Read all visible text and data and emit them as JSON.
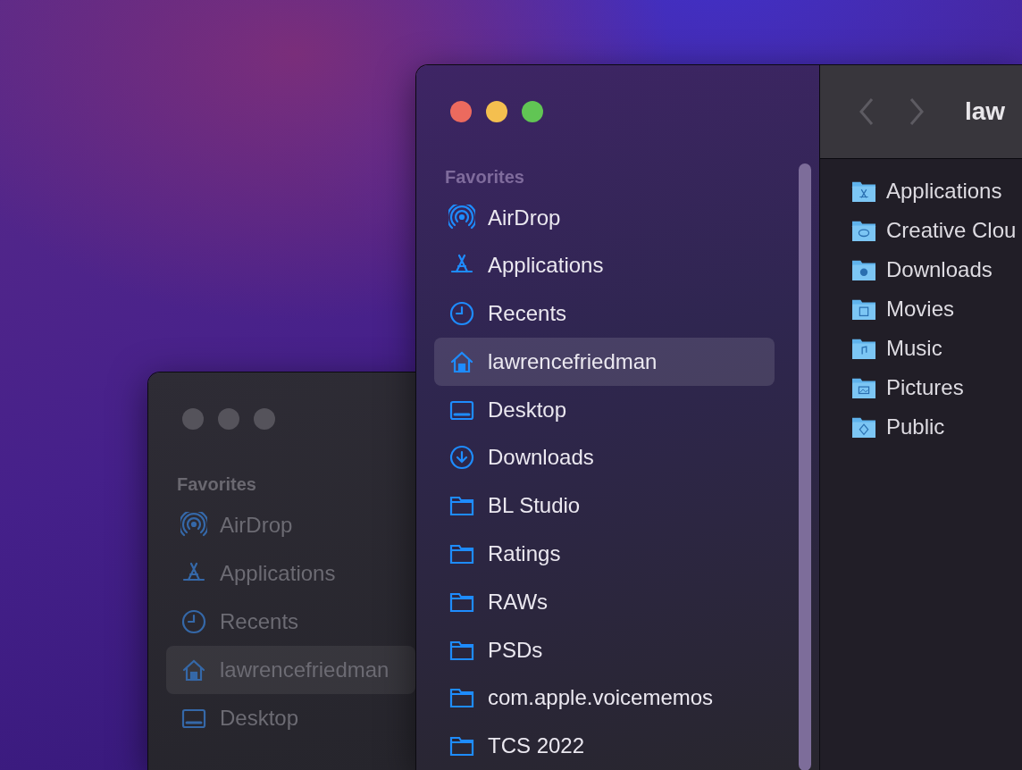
{
  "front_window": {
    "active": true,
    "title": "law",
    "sidebar": {
      "section": "Favorites",
      "items": [
        {
          "label": "AirDrop",
          "kind": "airdrop",
          "selected": false
        },
        {
          "label": "Applications",
          "kind": "apps",
          "selected": false
        },
        {
          "label": "Recents",
          "kind": "clock",
          "selected": false
        },
        {
          "label": "lawrencefriedman",
          "kind": "home",
          "selected": true
        },
        {
          "label": "Desktop",
          "kind": "desktop",
          "selected": false
        },
        {
          "label": "Downloads",
          "kind": "download",
          "selected": false
        },
        {
          "label": "BL Studio",
          "kind": "folder",
          "selected": false
        },
        {
          "label": "Ratings",
          "kind": "folder",
          "selected": false
        },
        {
          "label": "RAWs",
          "kind": "folder",
          "selected": false
        },
        {
          "label": "PSDs",
          "kind": "folder",
          "selected": false
        },
        {
          "label": "com.apple.voicememos",
          "kind": "folder",
          "selected": false
        },
        {
          "label": "TCS 2022",
          "kind": "folder",
          "selected": false
        }
      ]
    },
    "files": [
      {
        "name": "Applications",
        "kind": "apps"
      },
      {
        "name": "Creative Clou",
        "kind": "cloud"
      },
      {
        "name": "Downloads",
        "kind": "download"
      },
      {
        "name": "Movies",
        "kind": "film"
      },
      {
        "name": "Music",
        "kind": "music"
      },
      {
        "name": "Pictures",
        "kind": "photo"
      },
      {
        "name": "Public",
        "kind": "public"
      }
    ]
  },
  "back_window": {
    "active": false,
    "sidebar": {
      "section": "Favorites",
      "items": [
        {
          "label": "AirDrop",
          "kind": "airdrop",
          "selected": false
        },
        {
          "label": "Applications",
          "kind": "apps",
          "selected": false
        },
        {
          "label": "Recents",
          "kind": "clock",
          "selected": false
        },
        {
          "label": "lawrencefriedman",
          "kind": "home",
          "selected": true
        },
        {
          "label": "Desktop",
          "kind": "desktop",
          "selected": false
        }
      ]
    }
  }
}
